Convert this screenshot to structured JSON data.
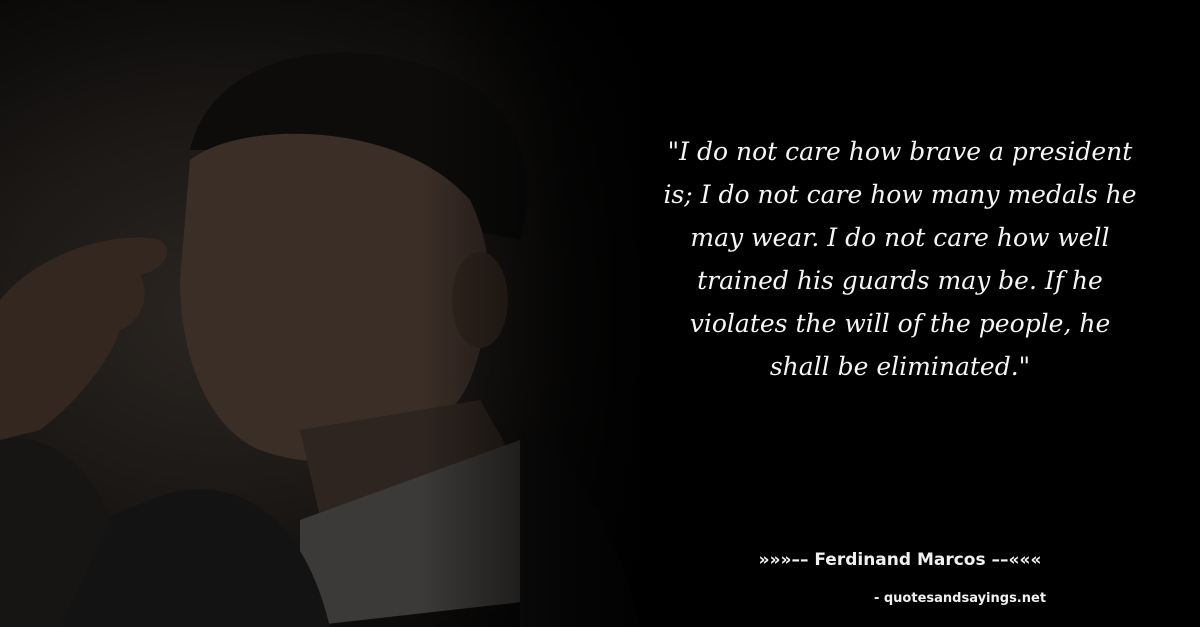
{
  "quote": {
    "text": "\"I do not care how brave a president\nis; I do not care how many medals he\nmay wear. I do not care how well\ntrained his guards may be. If he\nviolates the will of the people, he\nshall be eliminated.\""
  },
  "attribution": {
    "author_line": "»»»–– Ferdinand Marcos ––«««",
    "source_line": "- quotesandsayings.net"
  },
  "colors": {
    "background": "#000000",
    "text": "#f5f5f5"
  }
}
